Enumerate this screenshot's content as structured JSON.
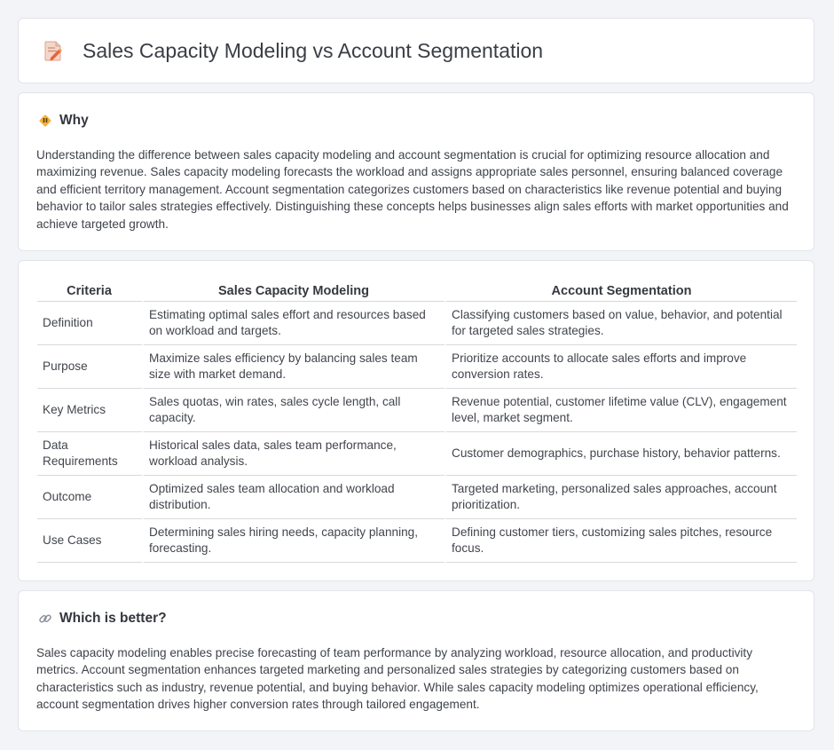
{
  "header": {
    "title": "Sales Capacity Modeling vs Account Segmentation",
    "icon": "document-pencil-icon"
  },
  "why": {
    "icon": "diamond-warning-icon",
    "title": "Why",
    "body": "Understanding the difference between sales capacity modeling and account segmentation is crucial for optimizing resource allocation and maximizing revenue. Sales capacity modeling forecasts the workload and assigns appropriate sales personnel, ensuring balanced coverage and efficient territory management. Account segmentation categorizes customers based on characteristics like revenue potential and buying behavior to tailor sales strategies effectively. Distinguishing these concepts helps businesses align sales efforts with market opportunities and achieve targeted growth."
  },
  "table": {
    "headers": [
      "Criteria",
      "Sales Capacity Modeling",
      "Account Segmentation"
    ],
    "rows": [
      [
        "Definition",
        "Estimating optimal sales effort and resources based on workload and targets.",
        "Classifying customers based on value, behavior, and potential for targeted sales strategies."
      ],
      [
        "Purpose",
        "Maximize sales efficiency by balancing sales team size with market demand.",
        "Prioritize accounts to allocate sales efforts and improve conversion rates."
      ],
      [
        "Key Metrics",
        "Sales quotas, win rates, sales cycle length, call capacity.",
        "Revenue potential, customer lifetime value (CLV), engagement level, market segment."
      ],
      [
        "Data Requirements",
        "Historical sales data, sales team performance, workload analysis.",
        "Customer demographics, purchase history, behavior patterns."
      ],
      [
        "Outcome",
        "Optimized sales team allocation and workload distribution.",
        "Targeted marketing, personalized sales approaches, account prioritization."
      ],
      [
        "Use Cases",
        "Determining sales hiring needs, capacity planning, forecasting.",
        "Defining customer tiers, customizing sales pitches, resource focus."
      ]
    ]
  },
  "better": {
    "icon": "link-icon",
    "title": "Which is better?",
    "body": "Sales capacity modeling enables precise forecasting of team performance by analyzing workload, resource allocation, and productivity metrics. Account segmentation enhances targeted marketing and personalized sales strategies by categorizing customers based on characteristics such as industry, revenue potential, and buying behavior. While sales capacity modeling optimizes operational efficiency, account segmentation drives higher conversion rates through tailored engagement."
  }
}
